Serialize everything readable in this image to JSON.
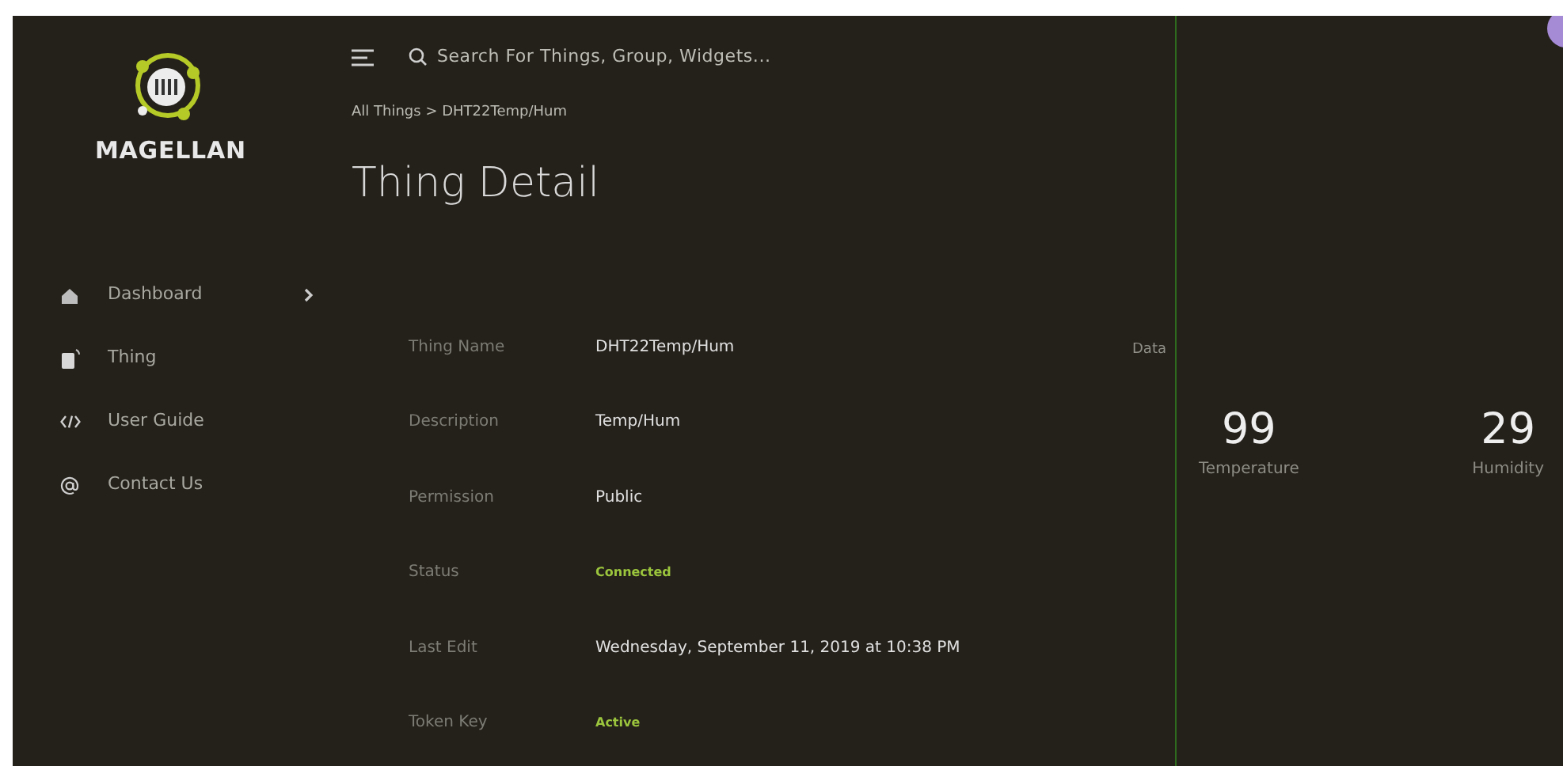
{
  "sidebar": {
    "brand": "MAGELLAN",
    "items": [
      {
        "label": "Dashboard",
        "expandable": true
      },
      {
        "label": "Thing",
        "expandable": false
      },
      {
        "label": "User Guide",
        "expandable": false
      },
      {
        "label": "Contact Us",
        "expandable": false
      }
    ]
  },
  "search": {
    "placeholder": "Search For Things, Group, Widgets..."
  },
  "breadcrumb": "All Things > DHT22Temp/Hum",
  "title": "Thing Detail",
  "details": [
    {
      "label": "Thing Name",
      "value": "DHT22Temp/Hum",
      "kind": "text"
    },
    {
      "label": "Description",
      "value": "Temp/Hum",
      "kind": "text"
    },
    {
      "label": "Permission",
      "value": "Public",
      "kind": "text"
    },
    {
      "label": "Status",
      "value": "Connected",
      "kind": "status"
    },
    {
      "label": "Last Edit",
      "value": "Wednesday, September 11, 2019 at 10:38 PM",
      "kind": "text"
    },
    {
      "label": "Token Key",
      "value": "Active",
      "kind": "status"
    }
  ],
  "data_label": "Data",
  "readings": [
    {
      "value": "99",
      "label": "Temperature"
    },
    {
      "value": "29",
      "label": "Humidity"
    }
  ]
}
